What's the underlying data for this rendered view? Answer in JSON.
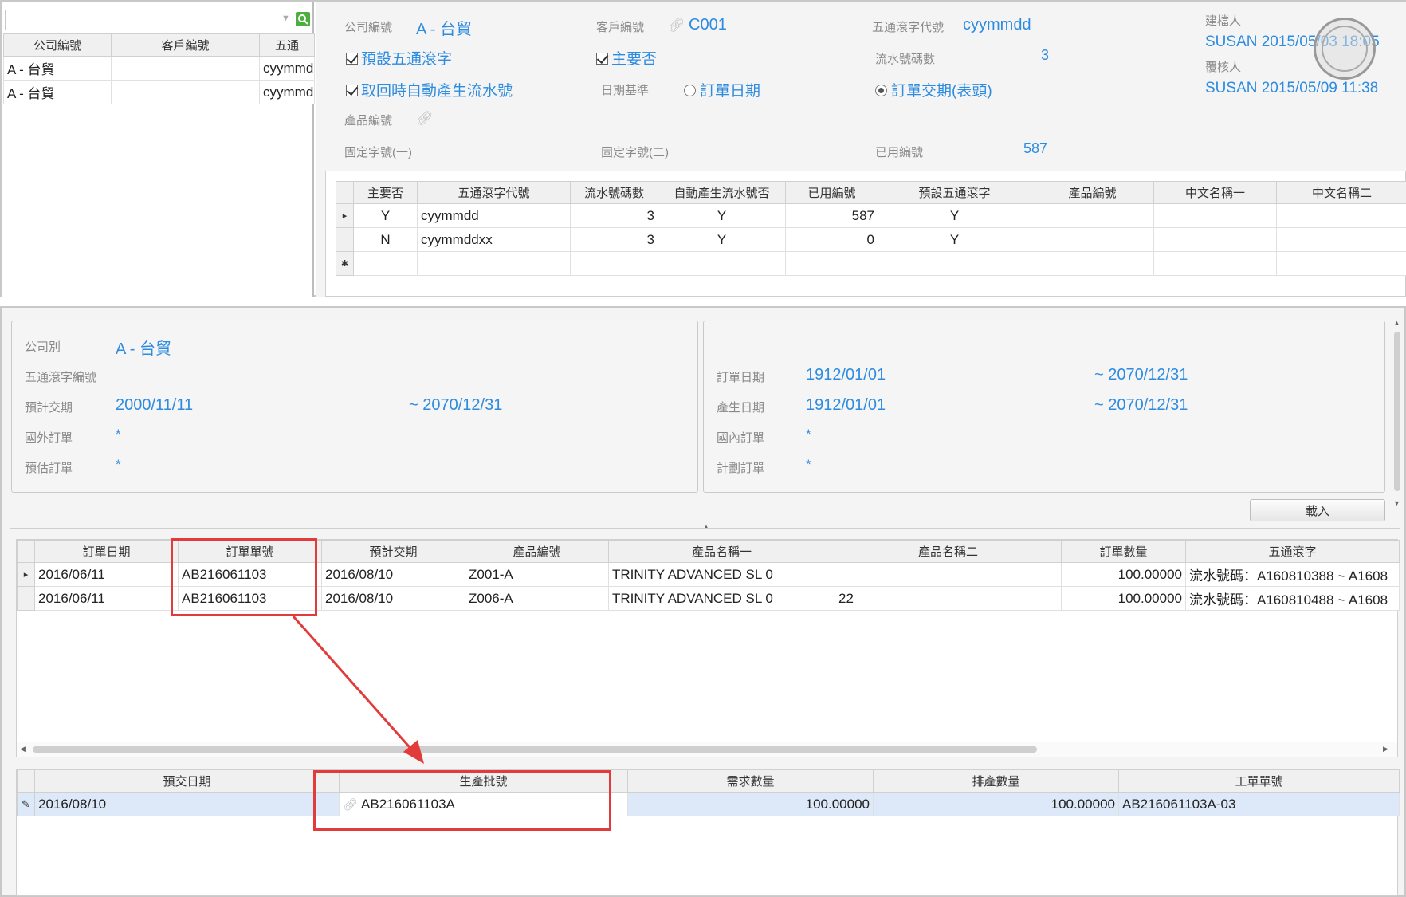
{
  "top_left": {
    "search_placeholder": "",
    "columns": [
      "公司編號",
      "客戶編號",
      "五通"
    ],
    "rows": [
      {
        "company": "A - 台貿",
        "customer": "",
        "code": "cyymmd"
      },
      {
        "company": "A - 台貿",
        "customer": "",
        "code": "cyymmd"
      }
    ]
  },
  "top_form": {
    "company_label": "公司編號",
    "company_value": "A - 台貿",
    "customer_label": "客戶編號",
    "customer_value": "C001",
    "code_label": "五通滾字代號",
    "code_value": "cyymmdd",
    "creator_label": "建檔人",
    "creator_value": "SUSAN 2015/05/03 18:05",
    "approver_label": "覆核人",
    "approver_value": "SUSAN 2015/05/09 11:38",
    "default_check": "預設五通滾字",
    "main_check": "主要否",
    "serial_len_label": "流水號碼數",
    "serial_len_value": "3",
    "auto_serial_check": "取回時自動產生流水號",
    "date_basis_label": "日期基準",
    "radio_order_date": "訂單日期",
    "radio_delivery": "訂單交期(表頭)",
    "product_label": "產品編號",
    "fixed1_label": "固定字號(一)",
    "fixed2_label": "固定字號(二)",
    "used_label": "已用編號",
    "used_value": "587"
  },
  "top_grid": {
    "columns": [
      "主要否",
      "五通滾字代號",
      "流水號碼數",
      "自動產生流水號否",
      "已用編號",
      "預設五通滾字",
      "產品編號",
      "中文名稱一",
      "中文名稱二"
    ],
    "rows": [
      {
        "main": "Y",
        "code": "cyymmdd",
        "len": "3",
        "auto": "Y",
        "used": "587",
        "def": "Y",
        "prod": "",
        "n1": "",
        "n2": ""
      },
      {
        "main": "N",
        "code": "cyymmddxx",
        "len": "3",
        "auto": "Y",
        "used": "0",
        "def": "Y",
        "prod": "",
        "n1": "",
        "n2": ""
      }
    ]
  },
  "filter": {
    "company_label": "公司別",
    "company_value": "A - 台貿",
    "code_label": "五通滾字編號",
    "delivery_label": "預計交期",
    "delivery_from": "2000/11/11",
    "delivery_to": "~ 2070/12/31",
    "foreign_label": "國外訂單",
    "foreign_value": "*",
    "estimate_label": "預估訂單",
    "estimate_value": "*",
    "order_date_label": "訂單日期",
    "order_date_from": "1912/01/01",
    "order_date_to": "~ 2070/12/31",
    "gen_date_label": "產生日期",
    "gen_date_from": "1912/01/01",
    "gen_date_to": "~ 2070/12/31",
    "domestic_label": "國內訂單",
    "domestic_value": "*",
    "plan_label": "計劃訂單",
    "plan_value": "*",
    "load_button": "載入"
  },
  "order_grid": {
    "columns": [
      "訂單日期",
      "訂單單號",
      "預計交期",
      "產品編號",
      "產品名稱一",
      "產品名稱二",
      "訂單數量",
      "五通滾字"
    ],
    "rows": [
      {
        "date": "2016/06/11",
        "no": "AB216061103",
        "due": "2016/08/10",
        "prod": "Z001-A",
        "n1": "TRINITY ADVANCED SL 0",
        "n2": "",
        "qty": "100.00000",
        "code": "流水號碼：A160810388 ~ A1608"
      },
      {
        "date": "2016/06/11",
        "no": "AB216061103",
        "due": "2016/08/10",
        "prod": "Z006-A",
        "n1": "TRINITY ADVANCED SL 0",
        "n2": "22",
        "qty": "100.00000",
        "code": "流水號碼：A160810488 ~ A1608"
      }
    ]
  },
  "batch_grid": {
    "columns": [
      "預交日期",
      "生產批號",
      "需求數量",
      "排產數量",
      "工單單號"
    ],
    "rows": [
      {
        "date": "2016/08/10",
        "batch": "AB216061103A",
        "need": "100.00000",
        "sched": "100.00000",
        "wo": "AB216061103A-03"
      }
    ]
  },
  "colors": {
    "accent": "#2e8ce0",
    "highlight": "#e23b3b",
    "selected_row": "#dde8f8"
  }
}
